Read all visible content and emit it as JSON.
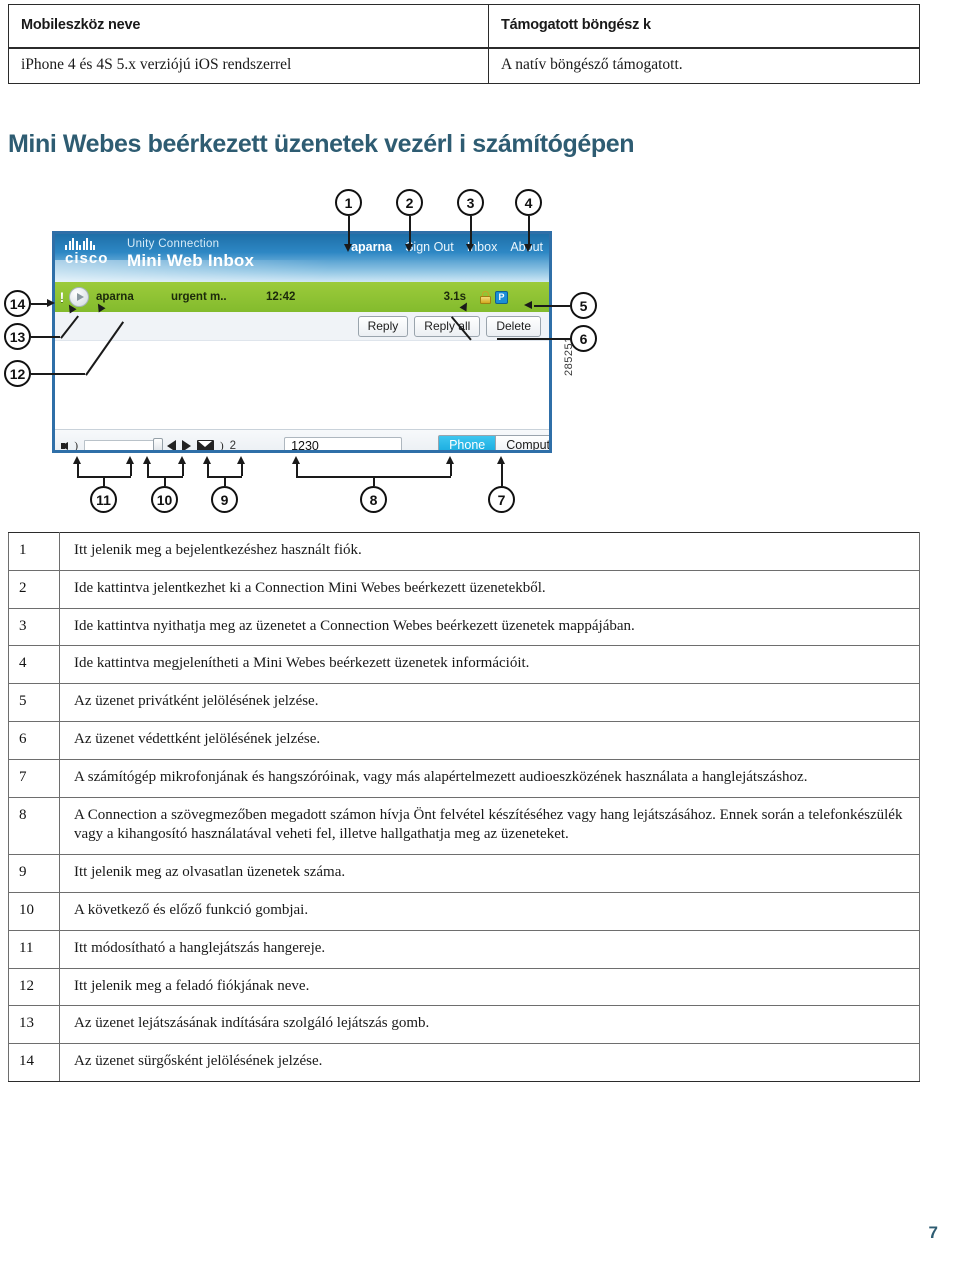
{
  "compat_table": {
    "headers": [
      "Mobileszköz neve",
      "Támogatott böngész k"
    ],
    "rows": [
      [
        "iPhone 4 és 4S 5.x verziójú iOS rendszerrel",
        "A natív böngésző támogatott."
      ]
    ]
  },
  "section": {
    "heading": "Mini Webes beérkezett üzenetek vezérl i számítógépen",
    "heading_color": "#2e5c72"
  },
  "figure": {
    "id_label": "285251",
    "app": {
      "brand_word": "cisco",
      "product_line1": "Unity Connection",
      "product_line2": "Mini Web Inbox",
      "header_links": [
        "aparna",
        "Sign Out",
        "Inbox",
        "About"
      ],
      "message_row": {
        "urgent_marker": "!",
        "from": "aparna",
        "subject": "urgent m..",
        "time": "12:42",
        "duration": "3.1s",
        "secure_icon": "lock-icon",
        "private_icon": "P"
      },
      "action_buttons": [
        "Reply",
        "Reply all",
        "Delete"
      ],
      "footer": {
        "volume_icon": "speaker-icon",
        "prev_icon": "previous-icon",
        "next_icon": "next-icon",
        "unread_icon": "envelope-icon",
        "unread_count": "2",
        "phone_number": "1230",
        "segmented": [
          "Phone",
          "Computer"
        ],
        "segmented_selected": "Phone"
      }
    },
    "callouts": [
      "1",
      "2",
      "3",
      "4",
      "5",
      "6",
      "7",
      "8",
      "9",
      "10",
      "11",
      "12",
      "13",
      "14"
    ]
  },
  "legend": {
    "items": [
      {
        "num": "1",
        "text": "Itt jelenik meg a bejelentkezéshez használt fiók."
      },
      {
        "num": "2",
        "text": "Ide kattintva jelentkezhet ki a Connection Mini Webes beérkezett üzenetekből."
      },
      {
        "num": "3",
        "text": "Ide kattintva nyithatja meg az üzenetet a Connection Webes beérkezett üzenetek mappájában."
      },
      {
        "num": "4",
        "text": "Ide kattintva megjelenítheti a Mini Webes beérkezett üzenetek információit."
      },
      {
        "num": "5",
        "text": "Az üzenet privátként jelölésének jelzése."
      },
      {
        "num": "6",
        "text": "Az üzenet védettként jelölésének jelzése."
      },
      {
        "num": "7",
        "text": "A számítógép mikrofonjának és hangszóróinak, vagy más alapértelmezett audioeszközének használata a hanglejátszáshoz."
      },
      {
        "num": "8",
        "text": "A Connection a szövegmezőben megadott számon hívja Önt felvétel készítéséhez vagy hang lejátszásához. Ennek során a telefonkészülék vagy a kihangosító használatával veheti fel, illetve hallgathatja meg az üzeneteket."
      },
      {
        "num": "9",
        "text": "Itt jelenik meg az olvasatlan üzenetek száma."
      },
      {
        "num": "10",
        "text": "A következő és előző funkció gombjai."
      },
      {
        "num": "11",
        "text": "Itt módosítható a hanglejátszás hangereje."
      },
      {
        "num": "12",
        "text": "Itt jelenik meg a feladó fiókjának neve."
      },
      {
        "num": "13",
        "text": "Az üzenet lejátszásának indítására szolgáló lejátszás gomb."
      },
      {
        "num": "14",
        "text": "Az üzenet sürgősként jelölésének jelzése."
      }
    ]
  },
  "page_number": "7"
}
